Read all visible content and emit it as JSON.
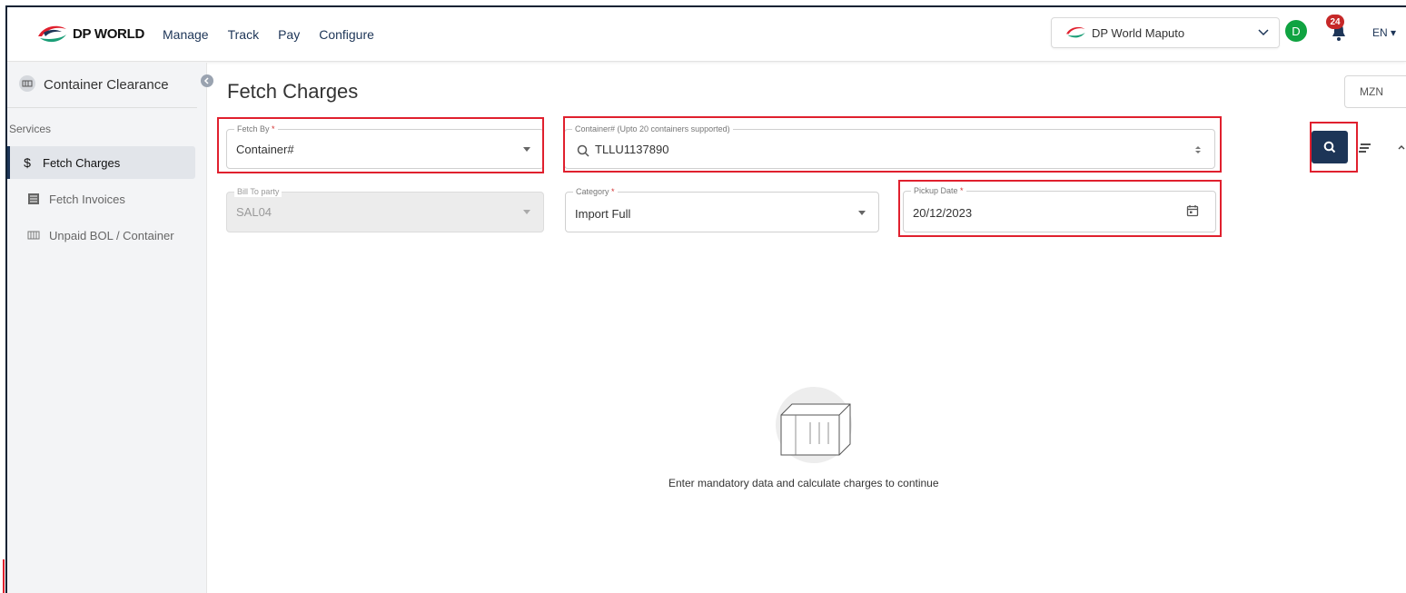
{
  "header": {
    "logo_text": "DP WORLD",
    "nav": [
      "Manage",
      "Track",
      "Pay",
      "Configure"
    ],
    "site": "DP World Maputo",
    "avatar_initial": "D",
    "notification_count": "24",
    "language": "EN ▾"
  },
  "sidebar": {
    "title": "Container Clearance",
    "section": "Services",
    "items": [
      {
        "label": "Fetch Charges",
        "icon": "dollar-icon",
        "active": true
      },
      {
        "label": "Fetch Invoices",
        "icon": "invoice-icon",
        "active": false
      },
      {
        "label": "Unpaid BOL / Container",
        "icon": "container-icon",
        "active": false
      }
    ]
  },
  "main": {
    "title": "Fetch Charges",
    "currency": "MZN",
    "fetch_by": {
      "label": "Fetch By",
      "required": "*",
      "value": "Container#"
    },
    "container": {
      "label": "Container# (Upto 20 containers supported)",
      "value": "TLLU1137890"
    },
    "bill_to": {
      "label": "Bill To party",
      "value": "SAL04"
    },
    "category": {
      "label": "Category",
      "required": "*",
      "value": "Import Full"
    },
    "pickup": {
      "label": "Pickup Date",
      "required": "*",
      "value": "20/12/2023"
    },
    "empty_message": "Enter mandatory data and calculate charges to continue"
  },
  "colors": {
    "primary": "#1d3557",
    "highlight": "#e0202e",
    "avatar": "#10a341",
    "badge": "#c62828"
  }
}
